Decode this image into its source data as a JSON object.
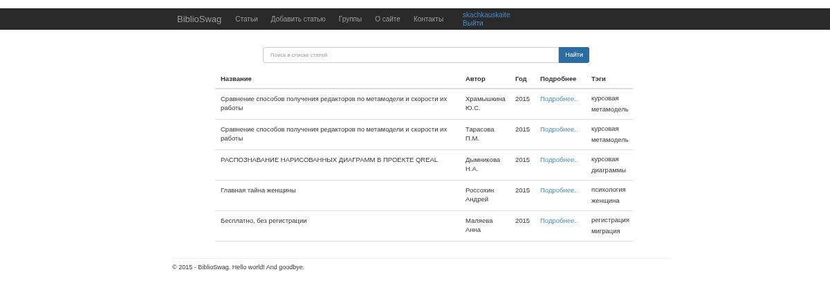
{
  "navbar": {
    "brand": "BiblioSwag",
    "links": [
      "Статьи",
      "Добавить статью",
      "Группы",
      "О сайте",
      "Контакты"
    ],
    "user": "skachkauskaite",
    "logout": "Выйти"
  },
  "search": {
    "placeholder": "Поиск в списке статей",
    "button": "Найти"
  },
  "table": {
    "columns": [
      "Название",
      "Автор",
      "Год",
      "Подробнее",
      "Тэги"
    ],
    "rows": [
      {
        "title": "Сравнение способов получения редакторов по метамодели и скорости их работы",
        "author": "Храмышкина Ю.С.",
        "year": "2015",
        "more": "Подробнее..",
        "tags": [
          "курсовая",
          "метамодель"
        ]
      },
      {
        "title": "Сравнение способов получения редакторов по метамодели и скорости их работы",
        "author": "Тарасова П.М.",
        "year": "2015",
        "more": "Подробнее..",
        "tags": [
          "курсовая",
          "метамодель"
        ]
      },
      {
        "title": "РАСПОЗНАВАНИЕ НАРИСОВАННЫХ ДИАГРАММ В ПРОЕКТЕ QREAL",
        "author": "Дымникова Н.А.",
        "year": "2015",
        "more": "Подробнее..",
        "tags": [
          "курсовая",
          "диаграммы"
        ]
      },
      {
        "title": "Главная тайна женщины",
        "author": "Россохин Андрей",
        "year": "2015",
        "more": "Подробнее..",
        "tags": [
          "психология",
          "женщина"
        ]
      },
      {
        "title": "Бесплатно, без регистрации",
        "author": "Маляева Анна",
        "year": "2015",
        "more": "Подробнее..",
        "tags": [
          "регистрация",
          "миграция"
        ]
      }
    ]
  },
  "footer": "© 2015 - BiblioSwag. Hello world! And goodbye."
}
